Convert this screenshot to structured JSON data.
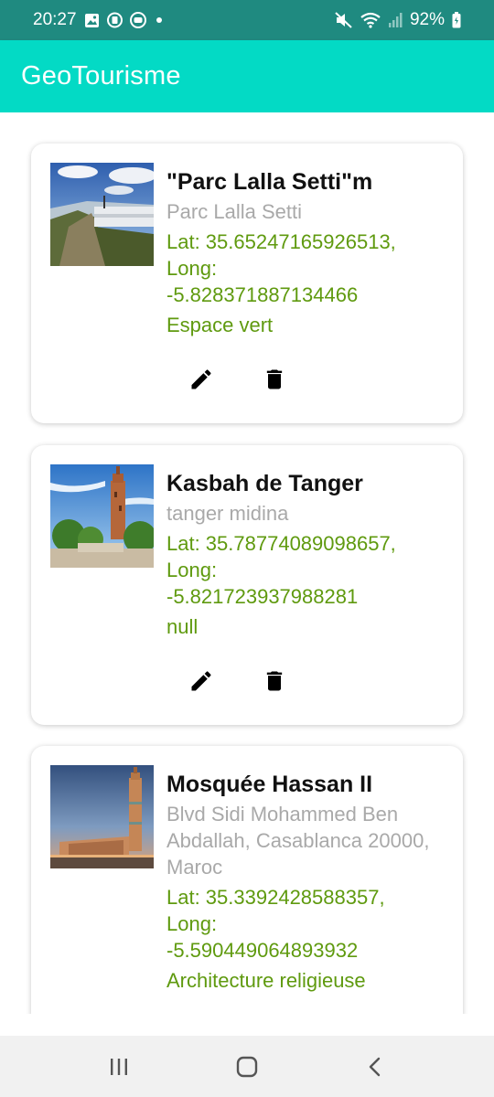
{
  "status_bar": {
    "time": "20:27",
    "left_icons": [
      "image-icon",
      "sim-icon",
      "messenger-icon",
      "dot-icon"
    ],
    "right_icons": [
      "mute-icon",
      "wifi-icon",
      "signal-icon"
    ],
    "battery": "92%"
  },
  "app_bar": {
    "title": "GeoTourisme"
  },
  "places": [
    {
      "title": "\"Parc Lalla Setti\"m",
      "address": "Parc Lalla Setti",
      "coords_lat": "Lat: 35.65247165926513,",
      "coords_long_label": "Long:",
      "coords_long": "-5.828371887134466",
      "category": "Espace vert",
      "image": "park-photo"
    },
    {
      "title": "Kasbah de Tanger",
      "address": "tanger midina",
      "coords_lat": "Lat: 35.78774089098657,",
      "coords_long_label": "Long:",
      "coords_long": "-5.821723937988281",
      "category": "null",
      "image": "kasbah-photo"
    },
    {
      "title": "Mosquée Hassan II",
      "address": "Blvd Sidi Mohammed Ben Abdallah, Casablanca 20000, Maroc",
      "coords_lat": "Lat: 35.3392428588357,",
      "coords_long_label": "Long:",
      "coords_long": "-5.590449064893932",
      "category": "Architecture religieuse",
      "image": "mosque-photo"
    }
  ],
  "actions": {
    "edit_icon": "pencil-icon",
    "delete_icon": "trash-icon"
  },
  "nav_bar": {
    "icons": [
      "recents-icon",
      "home-icon",
      "back-icon"
    ]
  },
  "colors": {
    "status_bar": "#1f8a80",
    "app_bar": "#03dac5",
    "coords_text": "#5f9a0f",
    "address_text": "#a9a9a9"
  }
}
